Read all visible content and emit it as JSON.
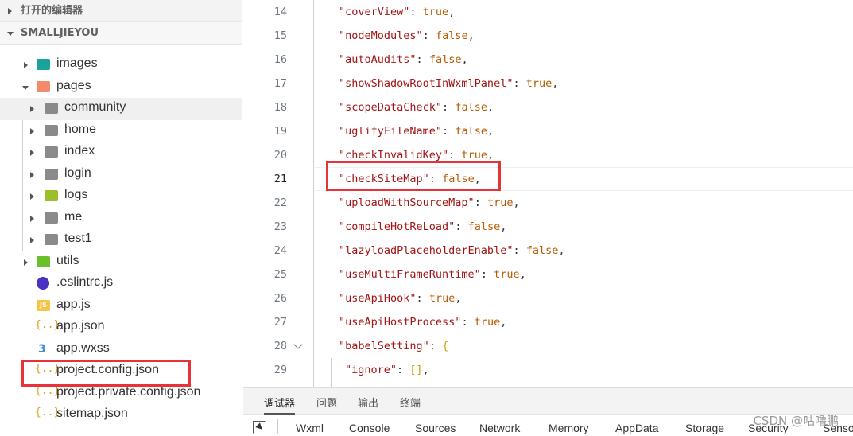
{
  "explorer": {
    "open_editors_label": "打开的编辑器",
    "project_label": "SMALLJIEYOU",
    "items": [
      {
        "label": "images",
        "icon": "folder-images-icon"
      },
      {
        "label": "pages",
        "icon": "folder-pages-icon"
      },
      {
        "label": "community",
        "icon": "folder-icon"
      },
      {
        "label": "home",
        "icon": "folder-icon"
      },
      {
        "label": "index",
        "icon": "folder-icon"
      },
      {
        "label": "login",
        "icon": "folder-icon"
      },
      {
        "label": "logs",
        "icon": "folder-logs-icon"
      },
      {
        "label": "me",
        "icon": "folder-icon"
      },
      {
        "label": "test1",
        "icon": "folder-icon"
      },
      {
        "label": "utils",
        "icon": "folder-utils-icon"
      },
      {
        "label": ".eslintrc.js",
        "icon": "eslint-icon"
      },
      {
        "label": "app.js",
        "icon": "js-file-icon",
        "badge": "JS"
      },
      {
        "label": "app.json",
        "icon": "json-file-icon",
        "badge": "{..}"
      },
      {
        "label": "app.wxss",
        "icon": "css-file-icon",
        "badge": "3"
      },
      {
        "label": "project.config.json",
        "icon": "json-file-icon",
        "badge": "{..}"
      },
      {
        "label": "project.private.config.json",
        "icon": "json-file-icon",
        "badge": "{..}"
      },
      {
        "label": "sitemap.json",
        "icon": "json-file-icon",
        "badge": "{..}"
      }
    ]
  },
  "editor": {
    "active_line": 21,
    "lines": [
      {
        "no": "14",
        "key": "\"coverView\"",
        "val": "true",
        "end": ","
      },
      {
        "no": "15",
        "key": "\"nodeModules\"",
        "val": "false",
        "end": ","
      },
      {
        "no": "16",
        "key": "\"autoAudits\"",
        "val": "false",
        "end": ","
      },
      {
        "no": "17",
        "key": "\"showShadowRootInWxmlPanel\"",
        "val": "true",
        "end": ","
      },
      {
        "no": "18",
        "key": "\"scopeDataCheck\"",
        "val": "false",
        "end": ","
      },
      {
        "no": "19",
        "key": "\"uglifyFileName\"",
        "val": "false",
        "end": ","
      },
      {
        "no": "20",
        "key": "\"checkInvalidKey\"",
        "val": "true",
        "end": ","
      },
      {
        "no": "21",
        "key": "\"checkSiteMap\"",
        "val": "false",
        "end": ","
      },
      {
        "no": "22",
        "key": "\"uploadWithSourceMap\"",
        "val": "true",
        "end": ","
      },
      {
        "no": "23",
        "key": "\"compileHotReLoad\"",
        "val": "false",
        "end": ","
      },
      {
        "no": "24",
        "key": "\"lazyloadPlaceholderEnable\"",
        "val": "false",
        "end": ","
      },
      {
        "no": "25",
        "key": "\"useMultiFrameRuntime\"",
        "val": "true",
        "end": ","
      },
      {
        "no": "26",
        "key": "\"useApiHook\"",
        "val": "true",
        "end": ","
      },
      {
        "no": "27",
        "key": "\"useApiHostProcess\"",
        "val": "true",
        "end": ","
      },
      {
        "no": "28",
        "key": "\"babelSetting\"",
        "val": "{",
        "end": ""
      },
      {
        "no": "29",
        "key": "\"ignore\"",
        "val": "[]",
        "end": ","
      }
    ]
  },
  "panel": {
    "tabs": [
      "调试器",
      "问题",
      "输出",
      "终端"
    ],
    "devtools_tabs": [
      "Wxml",
      "Console",
      "Sources",
      "Network",
      "Memory",
      "AppData",
      "Storage",
      "Security",
      "Senso"
    ]
  },
  "watermark": "CSDN @咕噜鹏",
  "colors": {
    "highlight": "#e8323a",
    "json_key": "#a31515",
    "json_value": "#b85a00"
  }
}
